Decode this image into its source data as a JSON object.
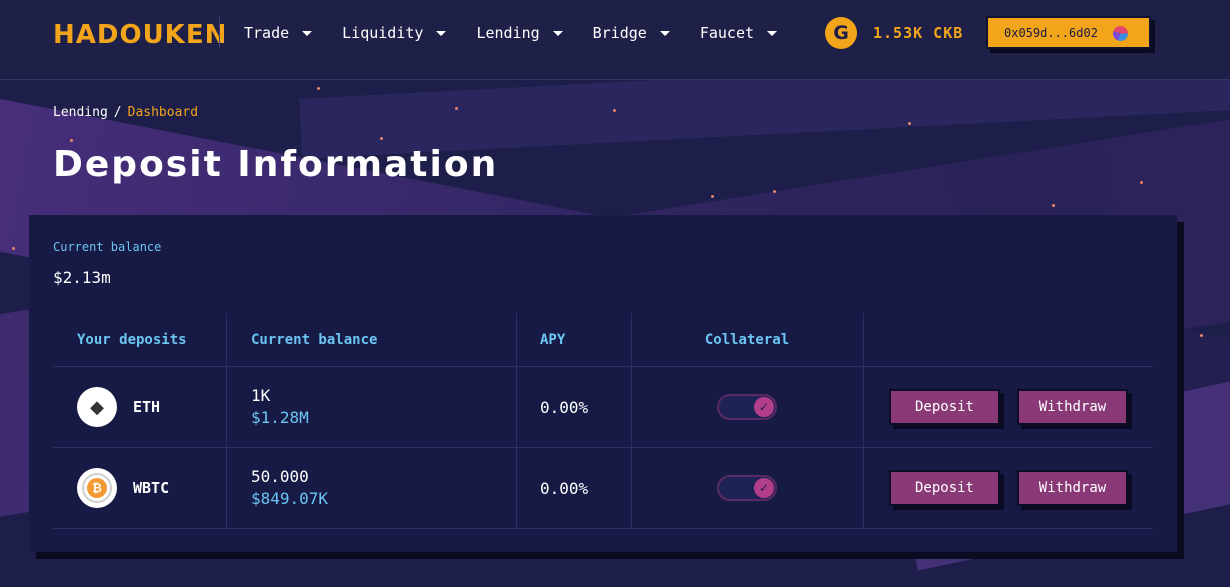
{
  "header": {
    "logo": "HADOUKEN",
    "nav": [
      {
        "label": "Trade"
      },
      {
        "label": "Liquidity"
      },
      {
        "label": "Lending"
      },
      {
        "label": "Bridge"
      },
      {
        "label": "Faucet"
      }
    ],
    "token_icon": "hadouken-token-icon",
    "balance": "1.53K CKB",
    "wallet_address": "0x059d...6d02"
  },
  "breadcrumb": {
    "parent": "Lending",
    "separator": "/",
    "current": "Dashboard"
  },
  "page_title": "Deposit Information",
  "summary": {
    "balance_label": "Current balance",
    "balance_value": "$2.13m"
  },
  "table": {
    "headers": {
      "asset": "Your deposits",
      "balance": "Current balance",
      "apy": "APY",
      "collateral": "Collateral"
    },
    "rows": [
      {
        "asset": "ETH",
        "icon": "ethereum-icon",
        "amount": "1K",
        "usd": "$1.28M",
        "apy": "0.00%",
        "collateral": true,
        "deposit_label": "Deposit",
        "withdraw_label": "Withdraw"
      },
      {
        "asset": "WBTC",
        "icon": "bitcoin-icon",
        "amount": "50.000",
        "usd": "$849.07K",
        "apy": "0.00%",
        "collateral": true,
        "deposit_label": "Deposit",
        "withdraw_label": "Withdraw"
      }
    ]
  },
  "colors": {
    "accent": "#f2a51a",
    "link": "#6cc5f2",
    "button": "#8a3977",
    "background": "#1d1e4a",
    "card": "#161a44"
  }
}
